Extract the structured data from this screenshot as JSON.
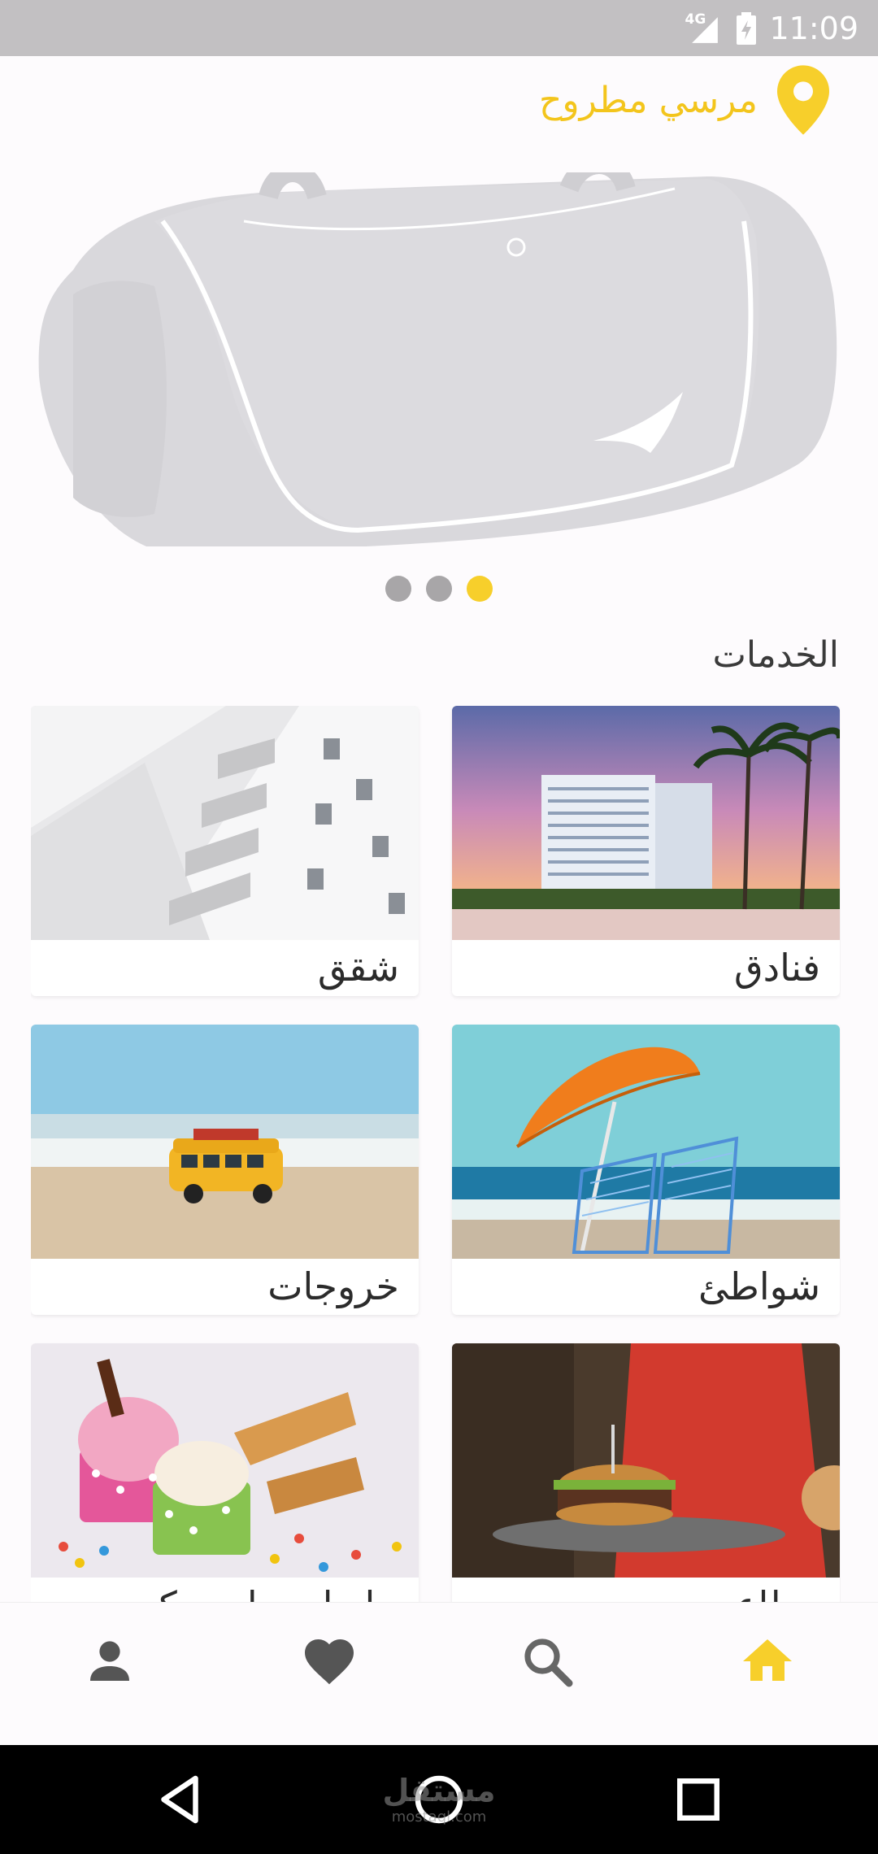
{
  "status_bar": {
    "network": "4G",
    "time": "11:09"
  },
  "location": {
    "name": "مرسي مطروح",
    "icon": "location-pin-icon",
    "color": "#f3c51c"
  },
  "carousel": {
    "slide_count": 3,
    "active_index": 2
  },
  "services": {
    "title": "الخدمات",
    "items": [
      {
        "label": "فنادق"
      },
      {
        "label": "شقق"
      },
      {
        "label": "شواطئ"
      },
      {
        "label": "خروجات"
      },
      {
        "label": "مطاعم"
      },
      {
        "label": "حلويات وايس كريم"
      }
    ]
  },
  "bottom_nav": {
    "items": [
      {
        "name": "home",
        "icon": "home-icon",
        "active": true
      },
      {
        "name": "search",
        "icon": "search-icon",
        "active": false
      },
      {
        "name": "favorites",
        "icon": "heart-icon",
        "active": false
      },
      {
        "name": "profile",
        "icon": "person-icon",
        "active": false
      }
    ],
    "active_color": "#f7cf2b",
    "inactive_color": "#555555"
  },
  "watermark": {
    "text": "مستقل",
    "sub": "mostaql.com"
  }
}
